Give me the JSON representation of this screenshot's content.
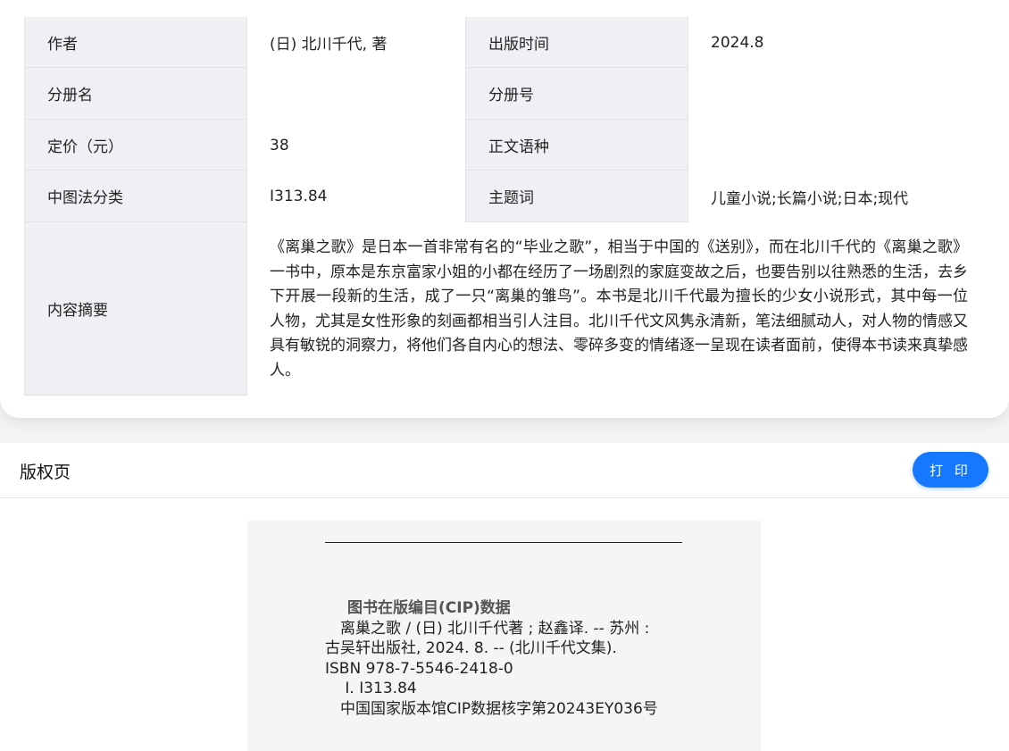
{
  "details": {
    "rows": [
      {
        "label1": "作者",
        "value1": "(日) 北川千代, 著",
        "label2": "出版时间",
        "value2": "2024.8"
      },
      {
        "label1": "分册名",
        "value1": "",
        "label2": "分册号",
        "value2": ""
      },
      {
        "label1": "定价（元）",
        "value1": "38",
        "label2": "正文语种",
        "value2": ""
      },
      {
        "label1": "中图法分类",
        "value1": "I313.84",
        "label2": "主题词",
        "value2": "儿童小说;长篇小说;日本;现代"
      }
    ],
    "summary_label": "内容摘要",
    "summary_text": "《离巢之歌》是日本一首非常有名的“毕业之歌”，相当于中国的《送别》，而在北川千代的《离巢之歌》一书中，原本是东京富家小姐的小都在经历了一场剧烈的家庭变故之后，也要告别以往熟悉的生活，去乡下开展一段新的生活，成了一只“离巢的雏鸟”。本书是北川千代最为擅长的少女小说形式，其中每一位人物，尤其是女性形象的刻画都相当引人注目。北川千代文风隽永清新，笔法细腻动人，对人物的情感又具有敏锐的洞察力，将他们各自内心的想法、零碎多变的情绪逐一呈现在读者面前，使得本书读来真挚感人。"
  },
  "copyright": {
    "title": "版权页",
    "print_label": "打 印",
    "cip_heading": "图书在版编目(CIP)数据",
    "cip_lines": [
      "　离巢之歌 / (日) 北川千代著 ; 赵鑫译. -- 苏州 :",
      "古吴轩出版社, 2024. 8. -- (北川千代文集).",
      "ISBN 978-7-5546-2418-0",
      "　 Ⅰ. I313.84",
      "　中国国家版本馆CIP数据核字第20243EY036号"
    ]
  },
  "colors": {
    "accent": "#1677ff",
    "label_bg": "#eef0f3",
    "cip_bg": "#f5f5f5"
  }
}
